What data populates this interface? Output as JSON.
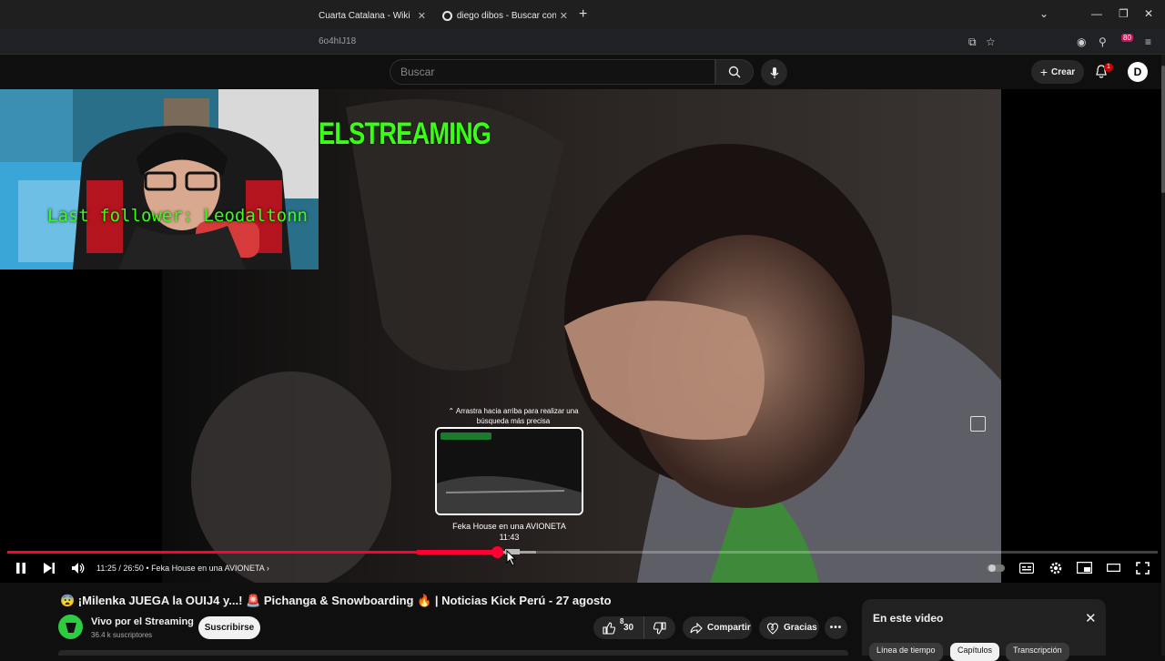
{
  "browser": {
    "tabs": [
      {
        "title": "Cuarta Catalana - Wikipedia, la",
        "icon": "wikipedia-icon"
      },
      {
        "title": "diego dibos - Buscar con Googl",
        "icon": "google-icon"
      }
    ],
    "url": "6o4hIJ18",
    "extension_badge": "80"
  },
  "youtube_header": {
    "search_placeholder": "Buscar",
    "create_label": "Crear",
    "notification_count": "1",
    "user_initial": "D"
  },
  "stream_overlay": {
    "title_text": "ELSTREAMING",
    "last_follower": "Last follower: Leodaltonn"
  },
  "player": {
    "drag_hint": "⌃ Arrastra hacia arriba para realizar una búsqueda más precisa",
    "preview_chapter": "Feka House en una AVIONETA",
    "preview_time": "11:43",
    "current_time": "11:25",
    "duration": "26:50",
    "time_display": "11:25 / 26:50",
    "chapter_label": "Feka House en una AVIONETA",
    "progress_fraction": 0.426,
    "buffered_fraction": 0.46
  },
  "video_info": {
    "title": "😨 ¡Milenka JUEGA la OUIJ4 y...! 🚨 Pichanga & Snowboarding 🔥 | Noticias Kick Perú - 27 agosto",
    "channel_name": "Vivo por el Streaming",
    "subscribers": "36.4 k suscriptores",
    "subscribe_label": "Suscribirse",
    "like_count_top": "8",
    "like_count": "30",
    "share_label": "Compartir",
    "thanks_label": "Gracias"
  },
  "side_panel": {
    "title": "En este video",
    "tabs": [
      "Línea de tiempo",
      "Capítulos",
      "Transcripción"
    ],
    "active_tab": "Capítulos"
  },
  "colors": {
    "accent_red": "#ff0033",
    "overlay_green": "#39ff14",
    "channel_green": "#2ecc40",
    "background": "#0f0f0f"
  }
}
